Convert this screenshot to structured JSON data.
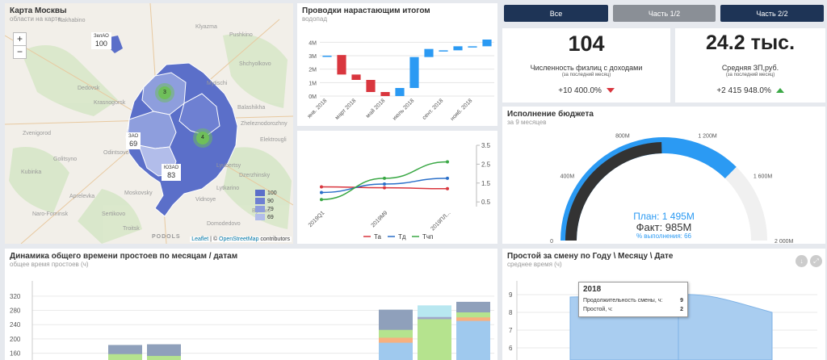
{
  "map": {
    "title": "Карта Москвы",
    "subtitle": "области на карте",
    "zoom_in": "+",
    "zoom_out": "−",
    "place_labels": [
      "Nakhabino",
      "Klyazma",
      "Pushkino",
      "Shchyolkovo",
      "Mytischi",
      "Dedovsk",
      "Krasnogorsk",
      "Balashikha",
      "Zvenigorod",
      "Odintsovo",
      "Zheleznodorozhny",
      "Elektrougli",
      "Lyubertsy",
      "Kubinka",
      "Aprelevka",
      "Dzerzhinsky",
      "Vidnoye",
      "Bykovo",
      "Moskovsky",
      "Domodedovo",
      "Naro-Fominsk",
      "Sertikovo",
      "Troitsk",
      "Golitsyno",
      "Lytkarino",
      "PODOLS"
    ],
    "districts": [
      {
        "name": "ЗелАО",
        "value": "100"
      },
      {
        "name": "ЗАО",
        "value": "69"
      },
      {
        "name": "ЮЗАО",
        "value": "83"
      }
    ],
    "clusters": [
      "3",
      "4"
    ],
    "legend": [
      {
        "label": "100",
        "color": "#5b6fc9"
      },
      {
        "label": "90",
        "color": "#6e80d2"
      },
      {
        "label": "79",
        "color": "#8e9edd"
      },
      {
        "label": "69",
        "color": "#b2bdea"
      }
    ],
    "attribution": {
      "leaflet": "Leaflet",
      "sep": " | © ",
      "osm": "OpenStreetMap",
      "suffix": " contributors"
    }
  },
  "waterfall": {
    "title": "Проводки нарастающим итогом",
    "subtitle": "водопад",
    "chart_data": {
      "type": "bar",
      "subtype": "waterfall",
      "categories": [
        "янв. 2018",
        "февр. 2018",
        "март 2018",
        "апр. 2018",
        "май 2018",
        "июнь 2018",
        "июль 2018",
        "авг. 2018",
        "сент. 2018",
        "окт. 2018",
        "нояб. 2018",
        "дек. 2018"
      ],
      "visible_tick_labels": [
        "янв. 2018",
        "март 2018",
        "май 2018",
        "июль 2018",
        "сент. 2018",
        "нояб. 2018"
      ],
      "bars": [
        {
          "start": 3.0,
          "end": 3.0
        },
        {
          "start": 3.05,
          "end": 1.6
        },
        {
          "start": 1.6,
          "end": 1.2
        },
        {
          "start": 1.2,
          "end": 0.3
        },
        {
          "start": 0.3,
          "end": 0.0
        },
        {
          "start": 0.0,
          "end": 0.6
        },
        {
          "start": 0.6,
          "end": 2.9
        },
        {
          "start": 2.9,
          "end": 3.5
        },
        {
          "start": 3.35,
          "end": 3.4
        },
        {
          "start": 3.4,
          "end": 3.7
        },
        {
          "start": 3.7,
          "end": 3.7
        },
        {
          "start": 3.7,
          "end": 4.2
        }
      ],
      "ylabels": [
        "4M",
        "3M",
        "2M",
        "1M",
        "0M"
      ],
      "ylim": [
        0,
        4.5
      ],
      "colors": {
        "increase": "#2b9af3",
        "decrease": "#d9363e"
      }
    }
  },
  "lines": {
    "chart_data": {
      "type": "line",
      "x": [
        "2019Q1",
        "2019M9",
        "2019ПЛ..."
      ],
      "series": [
        {
          "name": "Та",
          "color": "#d9363e",
          "values": [
            0.82,
            0.8,
            0.78
          ]
        },
        {
          "name": "Тд",
          "color": "#2a6fc9",
          "values": [
            0.7,
            0.88,
            1.0
          ]
        },
        {
          "name": "Тчп",
          "color": "#3aa845",
          "values": [
            0.55,
            1.0,
            1.35
          ]
        }
      ],
      "ylabels": [
        "3.5",
        "2.5",
        "1.5",
        "0.5"
      ],
      "ylabel_values": [
        1.7,
        1.3,
        0.9,
        0.5
      ],
      "ylim": [
        0.4,
        1.7
      ]
    }
  },
  "nav": {
    "buttons": [
      {
        "label": "Все",
        "color": "#1e3456"
      },
      {
        "label": "Часть 1/2",
        "color": "#8a8f96"
      },
      {
        "label": "Часть 2/2",
        "color": "#1e3456"
      }
    ]
  },
  "kpi1": {
    "value": "104",
    "label": "Численность физлиц с доходами",
    "note": "(за последний месяц)",
    "delta": "+10 400.0%",
    "arrow_color": "#d9363e"
  },
  "kpi2": {
    "value": "24.2 тыс.",
    "label": "Средняя ЗП,руб.",
    "note": "(за последний месяц)",
    "delta": "+2 415 948.0%",
    "arrow_color": "#3aa845"
  },
  "budget": {
    "title": "Исполнение бюджета",
    "subtitle": "за 9 месяцев",
    "chart_data": {
      "type": "gauge",
      "min": 0,
      "max": 2000,
      "ticks": [
        "0",
        "400M",
        "800M",
        "1 200M",
        "1 600M",
        "2 000M"
      ],
      "plan": 1495,
      "fact": 985,
      "percent": 66
    },
    "plan_label": "План: 1 495M",
    "fact_label": "Факт: 985M",
    "percent_label": "% выполнения: 66"
  },
  "downtime": {
    "title": "Динамика общего времени простоев по месяцам / датам",
    "subtitle": "общее время простоев (ч)",
    "chart_data": {
      "type": "bar",
      "stacked": true,
      "ylabels": [
        "320",
        "280",
        "240",
        "200",
        "160"
      ],
      "ylim": [
        150,
        340
      ],
      "bars": [
        {
          "segments": [
            {
              "value": 180,
              "color": "#b5e38e"
            },
            {
              "value": 3,
              "color": "#8fa0bb"
            }
          ]
        },
        {
          "segments": [
            {
              "value": 175,
              "color": "#b5e38e"
            },
            {
              "value": 10,
              "color": "#8fa0bb"
            }
          ]
        },
        {
          "segments": [
            {
              "value": 212,
              "color": "#9fc9ee"
            },
            {
              "value": 14,
              "color": "#f7b07f"
            },
            {
              "value": 22,
              "color": "#b5e38e"
            },
            {
              "value": 34,
              "color": "#8fa0bb"
            }
          ]
        },
        {
          "segments": [
            {
              "value": 278,
              "color": "#b5e38e"
            },
            {
              "value": 6,
              "color": "#9fa7c8"
            },
            {
              "value": 10,
              "color": "#b8e7f0"
            }
          ]
        },
        {
          "segments": [
            {
              "value": 273,
              "color": "#9fc9ee"
            },
            {
              "value": 10,
              "color": "#f7b07f"
            },
            {
              "value": 14,
              "color": "#b5e38e"
            },
            {
              "value": 7,
              "color": "#8fa0bb"
            }
          ]
        }
      ]
    }
  },
  "shift": {
    "title": "Простой за смену по Году \\ Месяцу \\ Дате",
    "subtitle": "среднее время (ч)",
    "chart_data": {
      "type": "area",
      "ylabels": [
        "9",
        "8",
        "7",
        "6"
      ],
      "ylim": [
        5.5,
        9.5
      ]
    },
    "tooltip": {
      "year": "2018",
      "rows": [
        {
          "label": "Продолжительность смены, ч:",
          "value": "9"
        },
        {
          "label": "Простой, ч:",
          "value": "2"
        }
      ]
    }
  }
}
